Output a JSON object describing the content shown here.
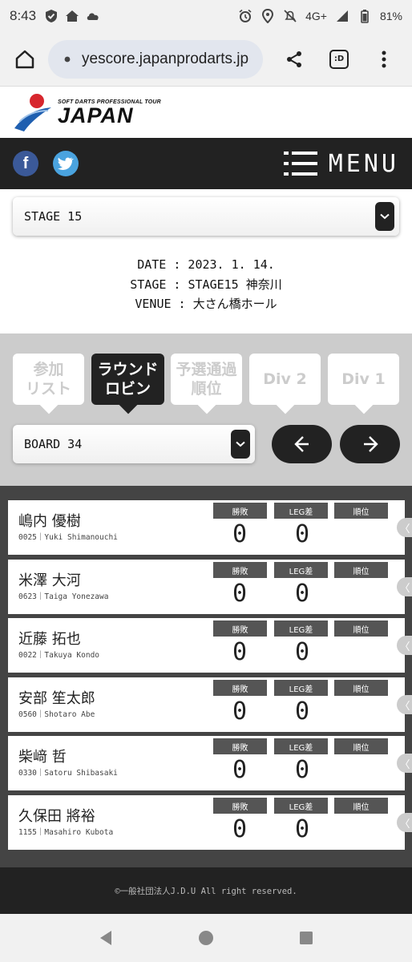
{
  "status_bar": {
    "time": "8:43",
    "network": "4G+",
    "battery": "81%",
    "left_icons": [
      "shield-icon",
      "home-icon",
      "cloud-icon"
    ],
    "right_icons": [
      "alarm-icon",
      "location-icon",
      "mute-icon",
      "signal-icon",
      "battery-icon"
    ]
  },
  "browser": {
    "url": "yescore.japanprodarts.jp",
    "tab_label": ":D"
  },
  "logo": {
    "subtitle": "SOFT DARTS PROFESSIONAL TOUR",
    "title": "JAPAN"
  },
  "nav": {
    "facebook_glyph": "f",
    "twitter_glyph": "t",
    "menu_label": "MENU"
  },
  "stage_select": {
    "value": "STAGE 15"
  },
  "event": {
    "date_line": "DATE : 2023. 1. 14.",
    "stage_line": "STAGE : STAGE15 神奈川",
    "venue_line": "VENUE : 大さん橋ホール"
  },
  "tabs": [
    {
      "label": "参加\nリスト",
      "active": false
    },
    {
      "label": "ラウンド\nロビン",
      "active": true
    },
    {
      "label": "予選通過\n順位",
      "active": false
    },
    {
      "label": "Div 2",
      "active": false
    },
    {
      "label": "Div 1",
      "active": false
    }
  ],
  "board_select": {
    "value": "BOARD 34"
  },
  "columns": {
    "win_loss": "勝敗",
    "leg_diff": "LEG差",
    "rank": "順位"
  },
  "players": [
    {
      "name": "嶋内 優樹",
      "sub": "0025｜Yuki Shimanouchi",
      "win_loss": "0",
      "leg_diff": "0"
    },
    {
      "name": "米澤 大河",
      "sub": "0623｜Taiga Yonezawa",
      "win_loss": "0",
      "leg_diff": "0"
    },
    {
      "name": "近藤 拓也",
      "sub": "0022｜Takuya Kondo",
      "win_loss": "0",
      "leg_diff": "0"
    },
    {
      "name": "安部 笙太郎",
      "sub": "0560｜Shotaro Abe",
      "win_loss": "0",
      "leg_diff": "0"
    },
    {
      "name": "柴﨑 哲",
      "sub": "0330｜Satoru Shibasaki",
      "win_loss": "0",
      "leg_diff": "0"
    },
    {
      "name": "久保田 將裕",
      "sub": "1155｜Masahiro Kubota",
      "win_loss": "0",
      "leg_diff": "0"
    }
  ],
  "side_glyph": "〈",
  "footer": {
    "copyright": "©一般社団法人J.D.U All right reserved."
  },
  "colors": {
    "nav_dark": "#222222",
    "gray_section": "#cccccc",
    "players_bg": "#444444",
    "facebook": "#3b5998",
    "twitter": "#4aa3df",
    "logo_red": "#d7262d",
    "logo_blue": "#1f5fb0"
  }
}
